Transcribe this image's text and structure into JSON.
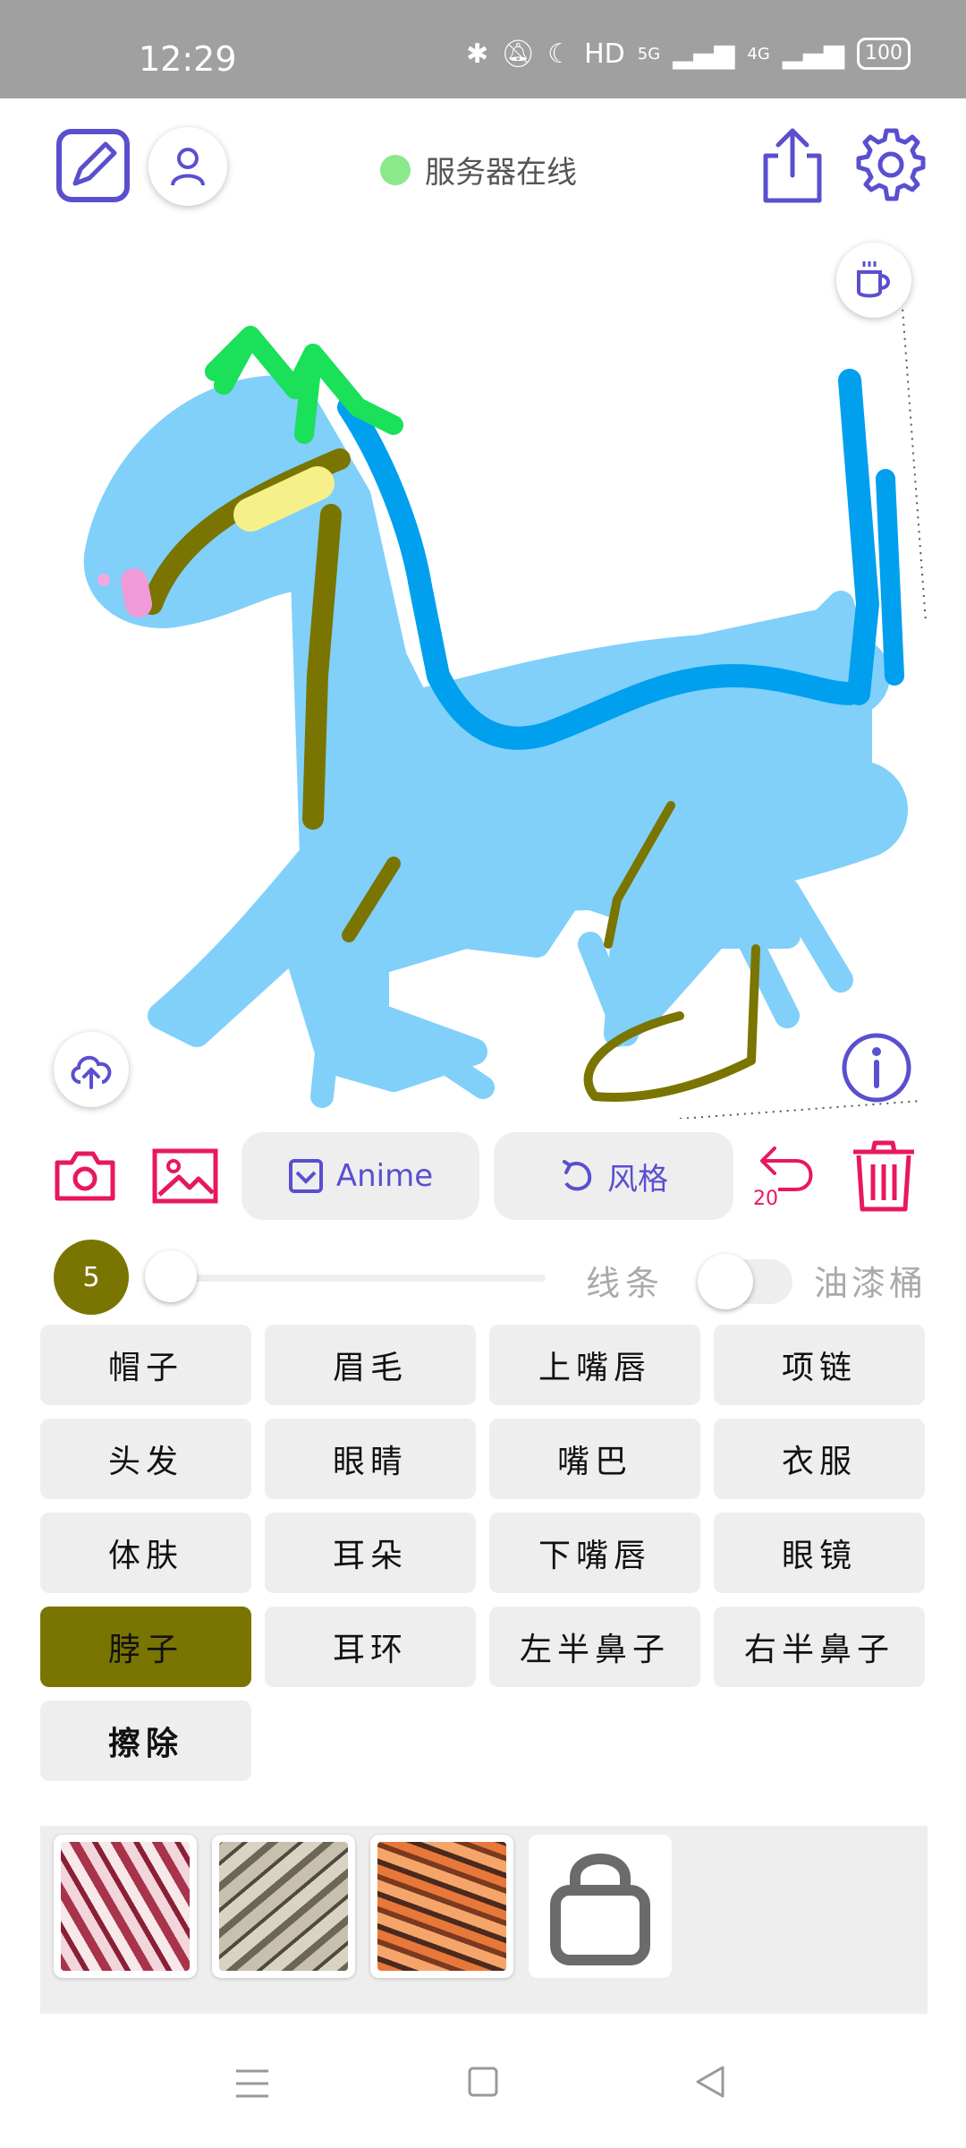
{
  "status_bar": {
    "time": "12:29",
    "hd_label": "HD",
    "net_5g": "5G",
    "net_4g": "4G",
    "battery": "100"
  },
  "header": {
    "server_status": "服务器在线",
    "server_status_color": "#8be88b",
    "accent_color": "#5a4fcf"
  },
  "toolbar": {
    "anime_label": "Anime",
    "style_label": "风格",
    "undo_count": "20",
    "danger_color": "#e8185c"
  },
  "brush": {
    "size": "5",
    "color": "#7a7500",
    "line_label": "线条",
    "bucket_label": "油漆桶"
  },
  "parts": [
    {
      "label": "帽子",
      "active": false
    },
    {
      "label": "眉毛",
      "active": false
    },
    {
      "label": "上嘴唇",
      "active": false
    },
    {
      "label": "项链",
      "active": false
    },
    {
      "label": "头发",
      "active": false
    },
    {
      "label": "眼睛",
      "active": false
    },
    {
      "label": "嘴巴",
      "active": false
    },
    {
      "label": "衣服",
      "active": false
    },
    {
      "label": "体肤",
      "active": false
    },
    {
      "label": "耳朵",
      "active": false
    },
    {
      "label": "下嘴唇",
      "active": false
    },
    {
      "label": "眼镜",
      "active": false
    },
    {
      "label": "脖子",
      "active": true
    },
    {
      "label": "耳环",
      "active": false
    },
    {
      "label": "左半鼻子",
      "active": false
    },
    {
      "label": "右半鼻子",
      "active": false
    },
    {
      "label": "擦除",
      "active": false
    }
  ],
  "swatches": [
    "crimson-marble",
    "grey-marble",
    "orange-marble",
    "locked"
  ]
}
